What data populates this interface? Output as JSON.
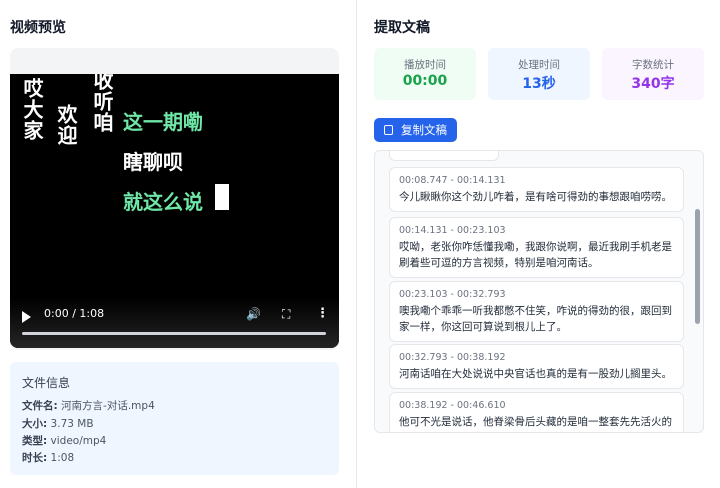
{
  "left": {
    "title": "视频预览",
    "video": {
      "vertical_texts": [
        "哎大家",
        "欢迎",
        "收听咱"
      ],
      "lines": [
        "这一期嘞",
        "瞎聊呗",
        "就这么说"
      ],
      "time": "0:00 / 1:08",
      "progress": 0
    },
    "file_info": {
      "title": "文件信息",
      "name_label": "文件名:",
      "name_value": "河南方言-对话.mp4",
      "size_label": "大小:",
      "size_value": "3.73 MB",
      "type_label": "类型:",
      "type_value": "video/mp4",
      "duration_label": "时长:",
      "duration_value": "1:08"
    }
  },
  "right": {
    "title": "提取文稿",
    "stats": [
      {
        "label": "播放时间",
        "value": "00:00",
        "color": "#16a34a",
        "bg": "#f0fdf4"
      },
      {
        "label": "处理时间",
        "value": "13秒",
        "color": "#2563eb",
        "bg": "#eff6ff"
      },
      {
        "label": "字数统计",
        "value": "340字",
        "color": "#9333ea",
        "bg": "#faf5ff"
      }
    ],
    "copy_label": "复制文稿",
    "segments": [
      {
        "time": "00:08.747 - 00:14.131",
        "text": "今儿瞅瞅你这个劲儿咋着，是有啥可得劲的事想跟咱唠唠。"
      },
      {
        "time": "00:14.131 - 00:23.103",
        "text": "哎呦，老张你咋恁懂我嘞，我跟你说啊，最近我刷手机老是刷着些可逗的方言视频，特别是咱河南话。"
      },
      {
        "time": "00:23.103 - 00:32.793",
        "text": "噢我嘞个乖乖一听我都憋不住笑，咋说的得劲的很，跟回到家一样，你这回可算说到根儿上了。"
      },
      {
        "time": "00:32.793 - 00:38.192",
        "text": "河南话咱在大处说说中央官话也真的是有一股劲儿搁里头。"
      },
      {
        "time": "00:38.192 - 00:46.610",
        "text": "他可不光是说话，他脊梁骨后头藏的是咱一整套先先活火的"
      }
    ]
  }
}
